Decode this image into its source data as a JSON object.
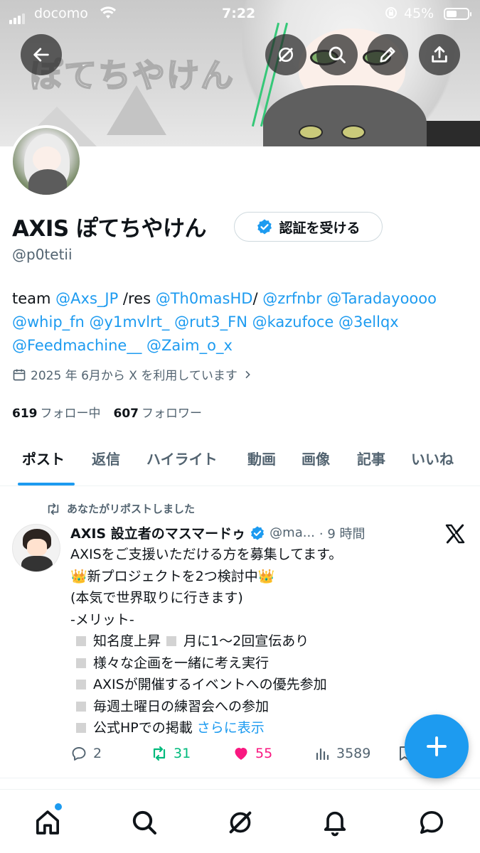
{
  "status_bar": {
    "carrier": "docomo",
    "time": "7:22",
    "battery": "45%"
  },
  "banner": {
    "text": "ぽてちやけん"
  },
  "profile": {
    "name": "AXIS ぽてちやけん",
    "verify_label": "認証を受ける",
    "handle": "@p0tetii",
    "bio": {
      "prefix": "team ",
      "m1": "@Axs_JP",
      "mid1": " /res ",
      "m2": "@Th0masHD",
      "mid2": "/ ",
      "m3": "@zrfnbr",
      "m4": "@Taradayoooo",
      "m5": "@whip_fn",
      "m6": "@y1mvlrt_",
      "m7": "@rut3_FN",
      "m8": "@kazufoce",
      "m9": "@3ellqx",
      "m10": "@Feedmachine__",
      "m11": "@Zaim_o_x"
    },
    "joined": "2025 年 6月から X を利用しています",
    "following_count": "619",
    "following_label": "フォロー中",
    "followers_count": "607",
    "followers_label": "フォロワー"
  },
  "tabs": [
    {
      "label": "ポスト"
    },
    {
      "label": "返信"
    },
    {
      "label": "ハイライト"
    },
    {
      "label": "動画"
    },
    {
      "label": "画像"
    },
    {
      "label": "記事"
    },
    {
      "label": "いいね"
    }
  ],
  "post": {
    "repost_note": "あなたがリポストしました",
    "author": "AXIS 設立者のマスマードゥ",
    "handle": "@ma...",
    "time": "· 9 時間",
    "lines": {
      "l1": "AXISをご支援いただける方を募集してます。",
      "l2_crown": "👑",
      "l2": "新プロジェクトを2つ検討中",
      "l3": "(本気で世界取りに行きます)",
      "l4": "-メリット-",
      "l5a": "知名度上昇",
      "l5b": "月に1〜2回宣伝あり",
      "l6": "様々な企画を一緒に考え実行",
      "l7": "AXISが開催するイベントへの優先参加",
      "l8": "毎週土曜日の練習会への参加",
      "l9": "公式HPでの掲載",
      "more": "さらに表示"
    },
    "replies": "2",
    "reposts": "31",
    "likes": "55",
    "views": "3589"
  },
  "colors": {
    "accent": "#1d9bf0",
    "repost_green": "#00ba7c",
    "like_pink": "#f91880",
    "secondary_text": "#536471"
  },
  "icons": [
    "back-arrow-icon",
    "grok-icon",
    "search-icon",
    "edit-icon",
    "share-icon",
    "home-icon",
    "explore-icon",
    "notifications-icon",
    "messages-icon",
    "compose-plus-icon"
  ]
}
